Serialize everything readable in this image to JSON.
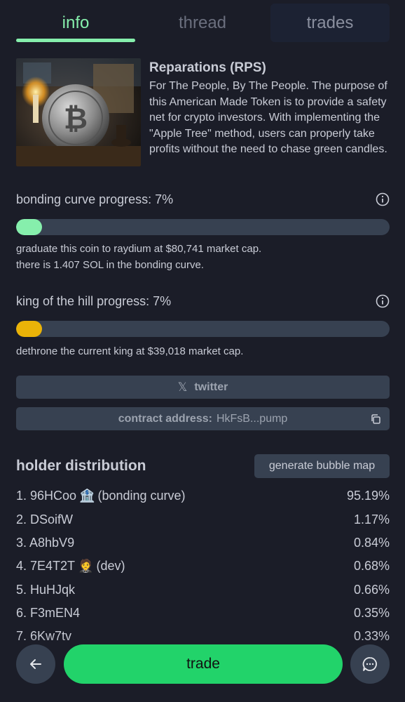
{
  "tabs": [
    {
      "label": "info"
    },
    {
      "label": "thread"
    },
    {
      "label": "trades"
    }
  ],
  "token": {
    "title": "Reparations (RPS)",
    "description": "For The People, By The People. The purpose of this American Made Token is to provide a safety net for crypto investors. With implementing the \"Apple Tree\" method, users can properly take profits without the need to chase green candles."
  },
  "bonding": {
    "label": "bonding curve progress: 7%",
    "progress": 0.07,
    "color": "#86efac",
    "line1": "graduate this coin to raydium at $80,741 market cap.",
    "line2": "there is 1.407 SOL in the bonding curve."
  },
  "king": {
    "label": "king of the hill progress: 7%",
    "progress": 0.07,
    "color": "#eab308",
    "line1": "dethrone the current king at $39,018 market cap."
  },
  "twitter": {
    "label": "twitter"
  },
  "contract": {
    "label": "contract address:",
    "value": "HkFsB...pump"
  },
  "holders": {
    "title": "holder distribution",
    "bubble_button": "generate bubble map",
    "rows": [
      {
        "name": "1. 96HCoo",
        "emoji": "🏦",
        "tag": "(bonding curve)",
        "pct": "95.19%"
      },
      {
        "name": "2. DSoifW",
        "emoji": "",
        "tag": "",
        "pct": "1.17%"
      },
      {
        "name": "3. A8hbV9",
        "emoji": "",
        "tag": "",
        "pct": "0.84%"
      },
      {
        "name": "4. 7E4T2T",
        "emoji": "🤵",
        "tag": "(dev)",
        "pct": "0.68%"
      },
      {
        "name": "5. HuHJqk",
        "emoji": "",
        "tag": "",
        "pct": "0.66%"
      },
      {
        "name": "6. F3mEN4",
        "emoji": "",
        "tag": "",
        "pct": "0.35%"
      },
      {
        "name": "7. 6Kw7tv",
        "emoji": "",
        "tag": "",
        "pct": "0.33%"
      }
    ]
  },
  "actions": {
    "trade": "trade"
  },
  "icons": {
    "back": "arrow-left-icon",
    "chat": "chat-bubble-icon",
    "info": "info-circle-icon",
    "copy": "copy-icon",
    "x": "x-logo-icon"
  }
}
